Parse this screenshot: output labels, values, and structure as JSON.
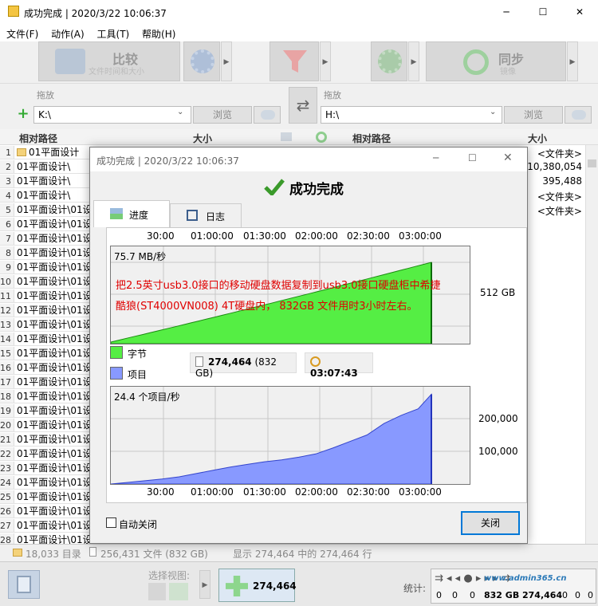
{
  "window": {
    "title": "成功完成 | 2020/3/22 10:06:37",
    "minimize": "─",
    "maximize": "☐",
    "close": "✕"
  },
  "menu": [
    "文件(F)",
    "动作(A)",
    "工具(T)",
    "帮助(H)"
  ],
  "toolbar": {
    "compare_label": "比较",
    "compare_sub": "文件时间和大小",
    "sync_label": "同步",
    "sync_sub": "镜像"
  },
  "paths": {
    "left_drop": "拖放",
    "right_drop": "拖放",
    "left_path": "K:\\",
    "right_path": "H:\\",
    "browse": "浏览"
  },
  "list": {
    "headers": {
      "left_path": "相对路径",
      "left_size": "大小",
      "right_path": "相对路径",
      "right_size": "大小"
    },
    "rows": [
      {
        "n": "1",
        "path": "01平面设计",
        "size": "<文件夹>"
      },
      {
        "n": "2",
        "path": "01平面设计\\",
        "size": "10,380,054"
      },
      {
        "n": "3",
        "path": "01平面设计\\",
        "size": "395,488"
      },
      {
        "n": "4",
        "path": "01平面设计\\",
        "size": "<文件夹>"
      },
      {
        "n": "5",
        "path": "01平面设计\\01设",
        "size": "<文件夹>"
      },
      {
        "n": "6",
        "path": "01平面设计\\01设",
        "size": ""
      },
      {
        "n": "7",
        "path": "01平面设计\\01设",
        "size": ""
      },
      {
        "n": "8",
        "path": "01平面设计\\01设",
        "size": ""
      },
      {
        "n": "9",
        "path": "01平面设计\\01设",
        "size": ""
      },
      {
        "n": "10",
        "path": "01平面设计\\01设",
        "size": ""
      },
      {
        "n": "11",
        "path": "01平面设计\\01设",
        "size": ""
      },
      {
        "n": "12",
        "path": "01平面设计\\01设",
        "size": ""
      },
      {
        "n": "13",
        "path": "01平面设计\\01设",
        "size": ""
      },
      {
        "n": "14",
        "path": "01平面设计\\01设",
        "size": ""
      },
      {
        "n": "15",
        "path": "01平面设计\\01设",
        "size": ""
      },
      {
        "n": "16",
        "path": "01平面设计\\01设",
        "size": ""
      },
      {
        "n": "17",
        "path": "01平面设计\\01设",
        "size": ""
      },
      {
        "n": "18",
        "path": "01平面设计\\01设",
        "size": ""
      },
      {
        "n": "19",
        "path": "01平面设计\\01设",
        "size": ""
      },
      {
        "n": "20",
        "path": "01平面设计\\01设",
        "size": ""
      },
      {
        "n": "21",
        "path": "01平面设计\\01设",
        "size": ""
      },
      {
        "n": "22",
        "path": "01平面设计\\01设",
        "size": ""
      },
      {
        "n": "23",
        "path": "01平面设计\\01设",
        "size": ""
      },
      {
        "n": "24",
        "path": "01平面设计\\01设",
        "size": ""
      },
      {
        "n": "25",
        "path": "01平面设计\\01设",
        "size": ""
      },
      {
        "n": "26",
        "path": "01平面设计\\01设",
        "size": ""
      },
      {
        "n": "27",
        "path": "01平面设计\\01设",
        "size": ""
      },
      {
        "n": "28",
        "path": "01平面设计\\01设",
        "size": ""
      }
    ]
  },
  "status": {
    "dirs": "18,033 目录",
    "files": "256,431 文件 (832 GB)",
    "showing": "显示 274,464 中的 274,464 行"
  },
  "bottom": {
    "view_label": "选择视图:",
    "items_button": "274,464",
    "stats_label": "统计:",
    "stats": [
      "0",
      "0",
      "0",
      "832 GB",
      "274,464",
      "0",
      "0",
      "0"
    ],
    "watermark": "www.admin365.cn"
  },
  "dialog": {
    "title": "成功完成 | 2020/3/22 10:06:37",
    "heading": "成功完成",
    "tabs": [
      "进度",
      "日志"
    ],
    "bytes_rate": "75.7 MB/秒",
    "items_rate": "24.4 个项目/秒",
    "annotation_line1": "把2.5英寸usb3.0接口的移动硬盘数据复制到usb3.0接口硬盘柜中希捷",
    "annotation_line2": "酷狼(ST4000VN008) 4T硬盘内， 832GB 文件用时3小时左右。",
    "legend_bytes": "字节",
    "legend_items": "项目",
    "count_value": "274,464",
    "count_size": "(832 GB)",
    "elapsed": "03:07:43",
    "auto_close": "自动关闭",
    "close_button": "关闭",
    "bytes_color": "#55ee44",
    "items_color": "#8899ff"
  },
  "chart_data": [
    {
      "type": "area",
      "series": [
        {
          "name": "字节",
          "x": [
            "0:00",
            "3:07:43"
          ],
          "values": [
            0,
            832
          ]
        }
      ],
      "x_ticks": [
        "30:00",
        "01:00:00",
        "01:30:00",
        "02:00:00",
        "02:30:00",
        "03:00:00"
      ],
      "y_ticks": [
        "512 GB"
      ],
      "unit": "GB",
      "grid": true
    },
    {
      "type": "area",
      "series": [
        {
          "name": "项目",
          "x": [
            0,
            10,
            20,
            30,
            40,
            50,
            60,
            70,
            80,
            90,
            100,
            110,
            120,
            130,
            140,
            150,
            160,
            170,
            180,
            187.7
          ],
          "values": [
            0,
            5000,
            10000,
            15000,
            22000,
            32000,
            42000,
            52000,
            60000,
            68000,
            74000,
            82000,
            92000,
            110000,
            130000,
            150000,
            185000,
            210000,
            230000,
            274464
          ]
        }
      ],
      "x_ticks": [
        "30:00",
        "01:00:00",
        "01:30:00",
        "02:00:00",
        "02:30:00",
        "03:00:00"
      ],
      "y_ticks": [
        "200,000",
        "100,000"
      ],
      "grid": true
    }
  ]
}
